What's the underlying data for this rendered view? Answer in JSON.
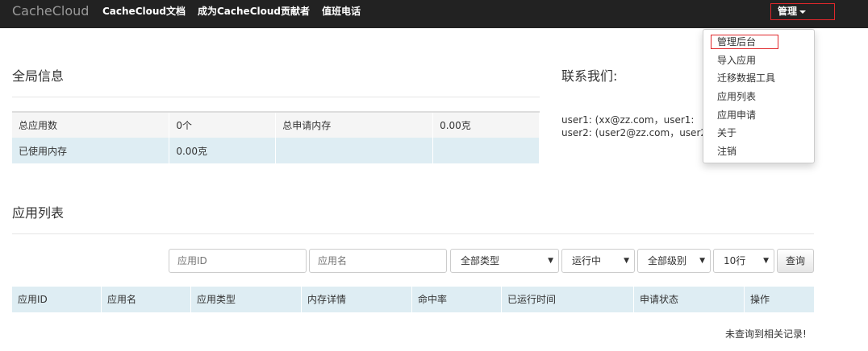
{
  "navbar": {
    "brand": "CacheCloud",
    "links": [
      "CacheCloud文档",
      "成为CacheCloud贡献者",
      "值班电话"
    ],
    "manage": "管理"
  },
  "global_info": {
    "title": "全局信息",
    "rows": [
      [
        "总应用数",
        "0个",
        "总申请内存",
        "0.00克"
      ],
      [
        "已使用内存",
        "0.00克",
        "",
        ""
      ]
    ]
  },
  "contact": {
    "title": "联系我们:",
    "lines": [
      "user1:  (xx@zz.com，user1: ",
      "user2:  (user2@zz.com，user2"
    ]
  },
  "dropdown": {
    "items": [
      "管理后台",
      "导入应用",
      "迁移数据工具",
      "应用列表",
      "应用申请",
      "关于",
      "注销"
    ]
  },
  "app_list": {
    "title": "应用列表",
    "filters": {
      "app_id_placeholder": "应用ID",
      "app_name_placeholder": "应用名",
      "type": "全部类型",
      "status": "运行中",
      "level": "全部级别",
      "page_size": "10行",
      "query": "查询"
    },
    "columns": [
      "应用ID",
      "应用名",
      "应用类型",
      "内存详情",
      "命中率",
      "已运行时间",
      "申请状态",
      "操作"
    ],
    "empty_text": "未查询到相关记录!"
  },
  "colors": {
    "navbar": "#222222",
    "highlight_border": "#e0272b",
    "table_header": "#deedf3"
  }
}
